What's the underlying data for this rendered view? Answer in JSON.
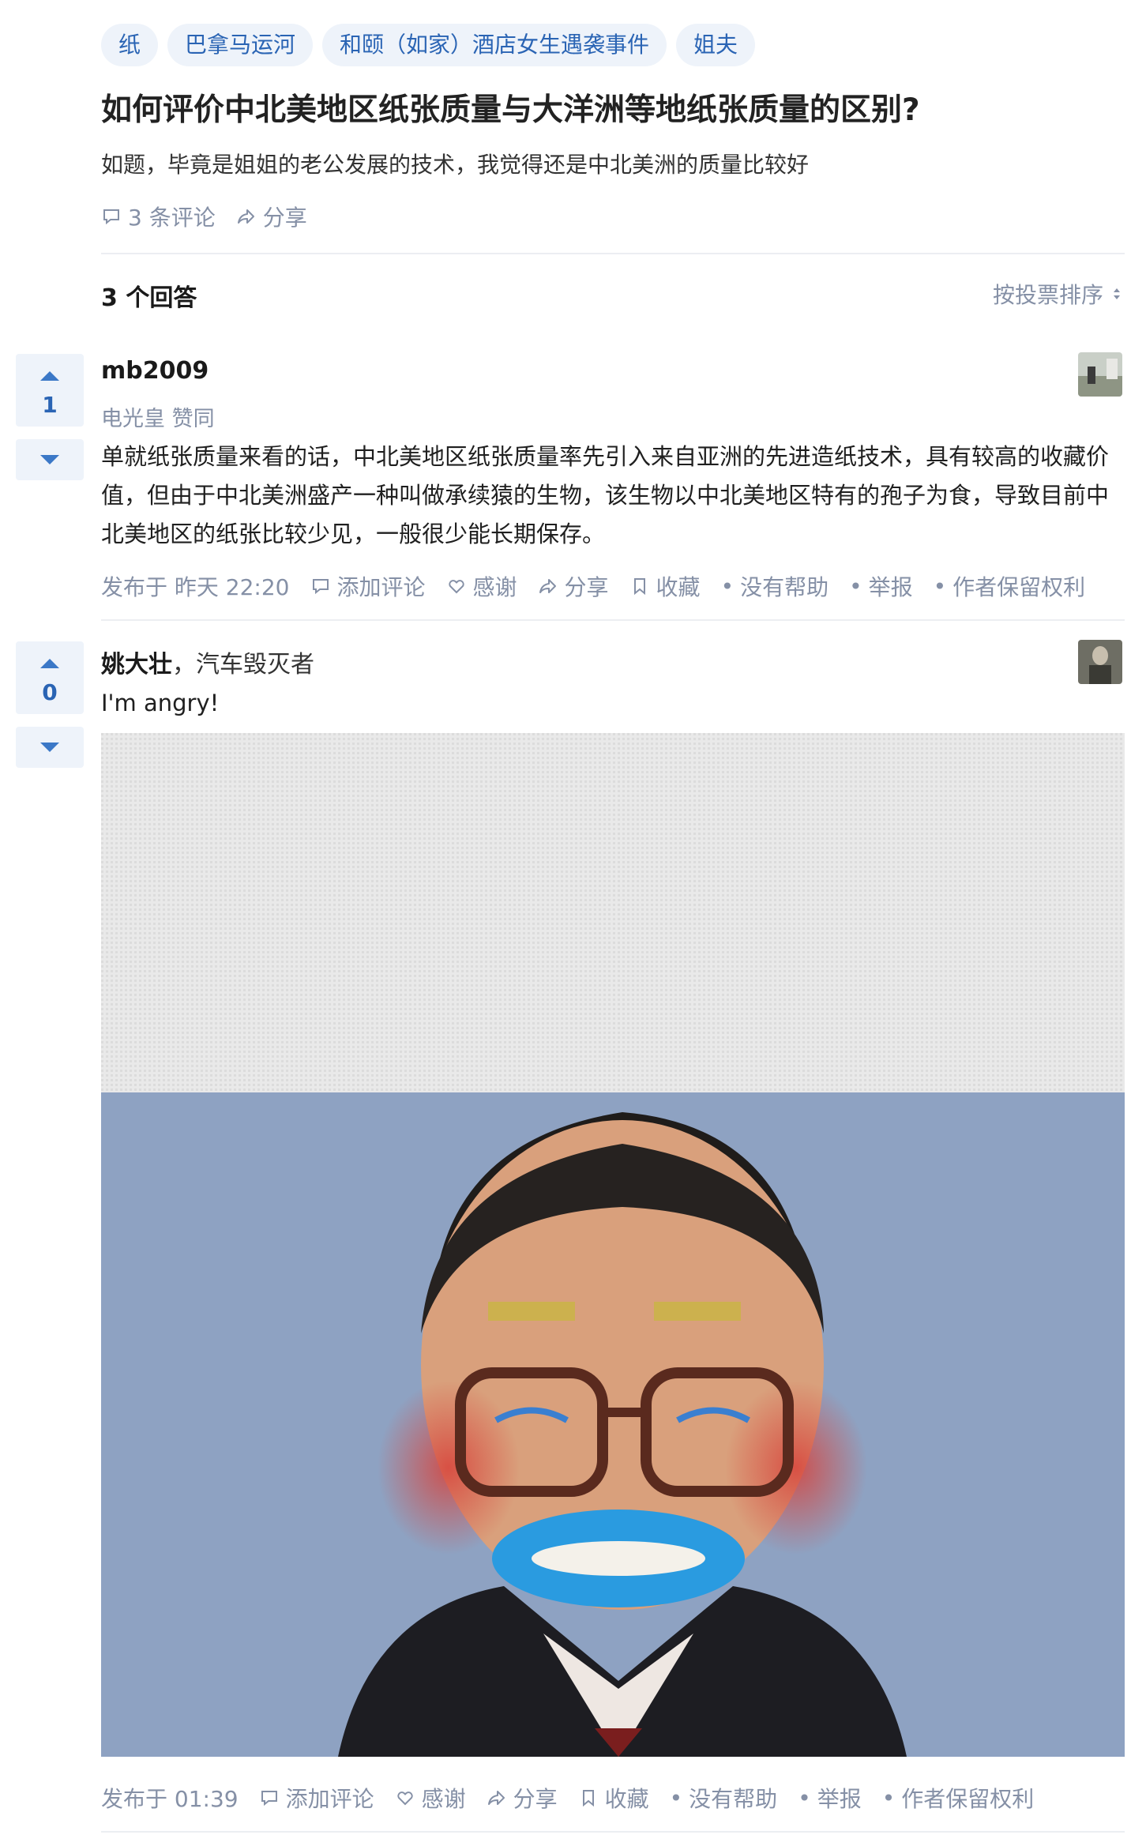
{
  "topics": [
    "纸",
    "巴拿马运河",
    "和颐（如家）酒店女生遇袭事件",
    "姐夫"
  ],
  "question": {
    "title": "如何评价中北美地区纸张质量与大洋洲等地纸张质量的区别?",
    "detail": "如题，毕竟是姐姐的老公发展的技术，我觉得还是中北美洲的质量比较好",
    "comments": "3 条评论",
    "share": "分享"
  },
  "answers_header": {
    "count_label": "3 个回答",
    "sort_label": "按投票排序"
  },
  "answers": [
    {
      "votes": "1",
      "author": "mb2009",
      "bio": "",
      "voters": "电光皇 赞同",
      "text": "单就纸张质量来看的话，中北美地区纸张质量率先引入来自亚洲的先进造纸技术，具有较高的收藏价值，但由于中北美洲盛产一种叫做承续猿的生物，该生物以中北美地区特有的孢子为食，导致目前中北美地区的纸张比较少见，一般很少能长期保存。",
      "published": "发布于 昨天 22:20",
      "actions": {
        "comment": "添加评论",
        "thanks": "感谢",
        "share": "分享",
        "collect": "收藏",
        "no_help": "没有帮助",
        "report": "举报",
        "rights": "作者保留权利"
      }
    },
    {
      "votes": "0",
      "author": "姚大壮",
      "bio": "，汽车毁灭者",
      "voters": "",
      "text": "I'm angry!",
      "published": "发布于 01:39",
      "actions": {
        "comment": "添加评论",
        "thanks": "感谢",
        "share": "分享",
        "collect": "收藏",
        "no_help": "没有帮助",
        "report": "举报",
        "rights": "作者保留权利"
      }
    }
  ],
  "colors": {
    "link": "#2a64b4",
    "meta": "#8590a6",
    "vote_bg": "#eef3fa"
  }
}
